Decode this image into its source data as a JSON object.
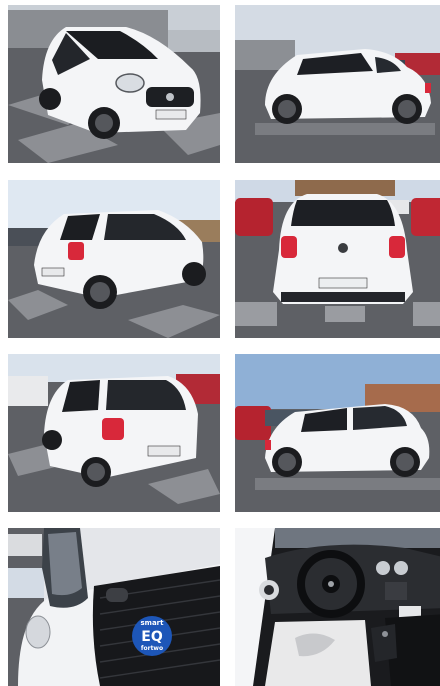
{
  "gallery": {
    "photos": [
      {
        "subject": "front-three-quarter-left"
      },
      {
        "subject": "side-profile-right"
      },
      {
        "subject": "rear-three-quarter-left"
      },
      {
        "subject": "rear-view"
      },
      {
        "subject": "rear-three-quarter-left-close"
      },
      {
        "subject": "side-profile-left"
      },
      {
        "subject": "front-grille-eq-badge"
      },
      {
        "subject": "interior-dashboard"
      }
    ],
    "car_color": "#f4f5f7",
    "sky_color": "#cfd9e6",
    "pavement_color": "#5e6065",
    "tail_light_color": "#d8283a",
    "badge_color": "#1d56b8"
  },
  "badge": {
    "line1": "smart",
    "line2": "EQ",
    "line3": "fortwo"
  }
}
